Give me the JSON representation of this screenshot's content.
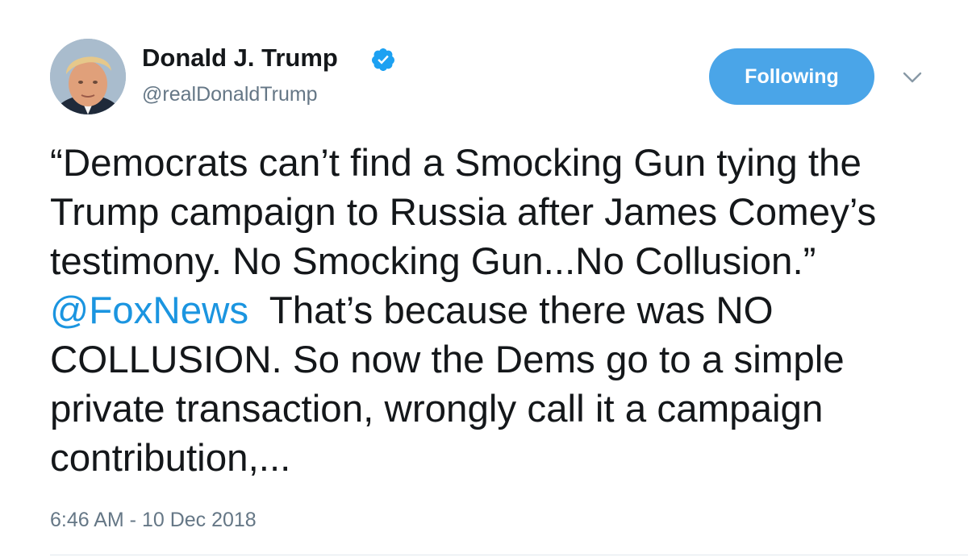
{
  "author": {
    "display_name": "Donald J. Trump",
    "handle": "@realDonaldTrump",
    "verified": true,
    "avatar_icon": "profile-photo"
  },
  "follow_button": {
    "label": "Following",
    "color": "#4aa5e8"
  },
  "menu": {
    "icon": "chevron-down-icon"
  },
  "tweet": {
    "text_before_mention": "“Democrats can’t find a Smocking Gun tying the Trump campaign to Russia after James Comey’s testimony. No Smocking Gun...No Collusion.”",
    "mention": "@FoxNews",
    "text_after_mention": "That’s because there was NO COLLUSION. So now the Dems go to a simple private transaction, wrongly call it a campaign contribution,...",
    "timestamp": "6:46 AM - 10 Dec 2018"
  },
  "colors": {
    "text": "#14171a",
    "secondary": "#657786",
    "link": "#1b95e0",
    "verified_badge": "#1da1f2"
  }
}
